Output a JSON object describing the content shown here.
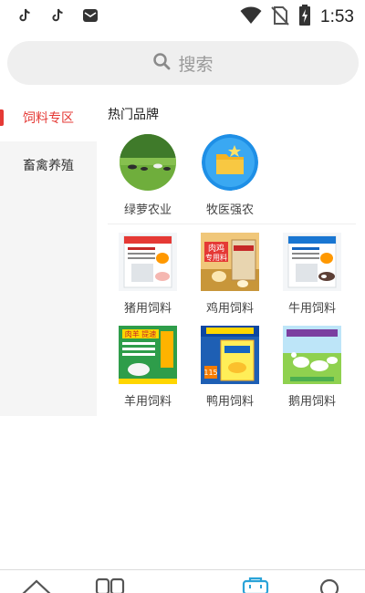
{
  "status_bar": {
    "time": "1:53",
    "left_icons": [
      "tiktok-icon",
      "tiktok-icon",
      "mail-app-icon"
    ],
    "right_icons": [
      "wifi-icon",
      "no-sim-icon",
      "battery-charging-icon"
    ]
  },
  "search": {
    "placeholder": "搜索"
  },
  "sidebar": {
    "items": [
      {
        "label": "饲料专区",
        "active": true
      },
      {
        "label": "畜禽养殖",
        "active": false
      }
    ]
  },
  "main": {
    "section_title": "热门品牌",
    "brands": [
      {
        "label": "绿萝农业"
      },
      {
        "label": "牧医强农"
      }
    ],
    "categories": [
      {
        "label": "猪用饲料"
      },
      {
        "label": "鸡用饲料"
      },
      {
        "label": "牛用饲料"
      },
      {
        "label": "羊用饲料"
      },
      {
        "label": "鸭用饲料"
      },
      {
        "label": "鹅用饲料"
      }
    ],
    "product_texts": {
      "chicken_bag": "肉鸡 专用料",
      "sheep_box": "肉羊 提速",
      "duck_number": "115"
    }
  },
  "bottom_nav": {
    "icons": [
      "home-icon",
      "category-icon",
      "center-icon",
      "cart-icon",
      "search-icon"
    ],
    "active_index": 3
  },
  "colors": {
    "accent": "#e53935",
    "active_nav": "#2aa3d8"
  }
}
